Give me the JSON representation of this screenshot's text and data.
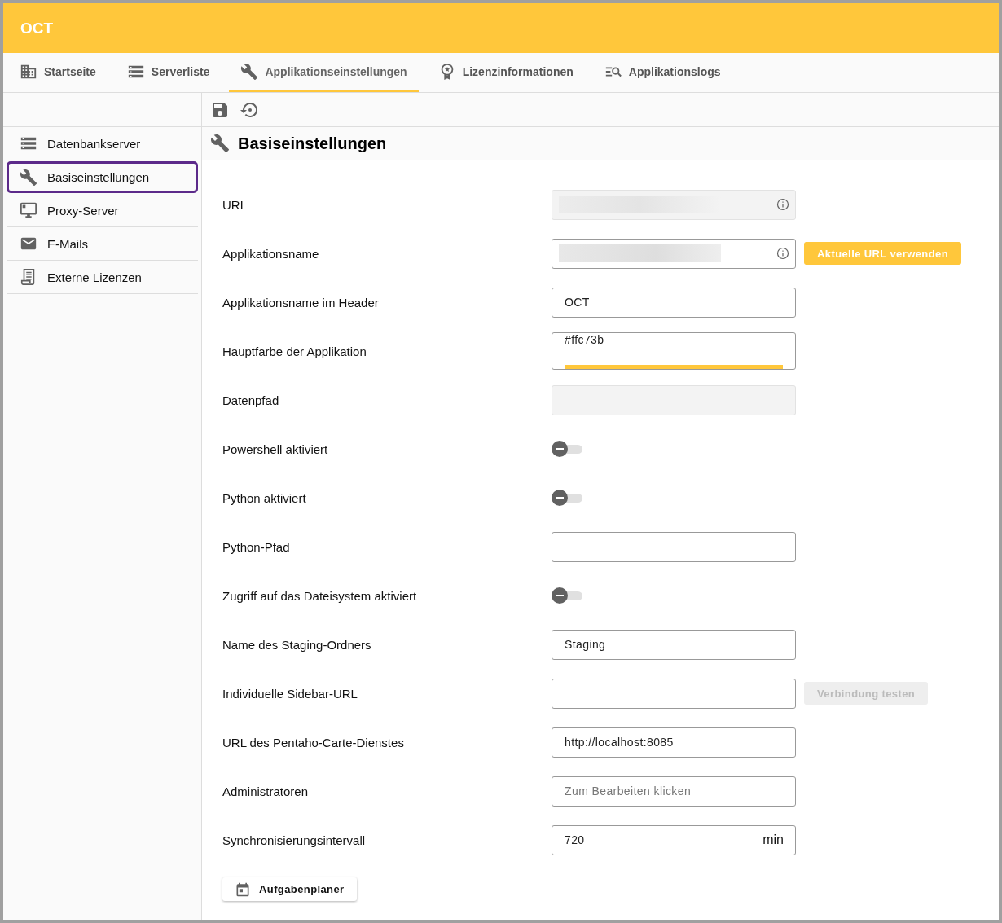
{
  "header": {
    "title": "OCT"
  },
  "tabs": [
    {
      "label": "Startseite",
      "selected": false
    },
    {
      "label": "Serverliste",
      "selected": false
    },
    {
      "label": "Applikationseinstellungen",
      "selected": true
    },
    {
      "label": "Lizenzinformationen",
      "selected": false
    },
    {
      "label": "Applikationslogs",
      "selected": false
    }
  ],
  "sidebar": {
    "items": [
      {
        "label": "Datenbankserver",
        "selected": false
      },
      {
        "label": "Basiseinstellungen",
        "selected": true
      },
      {
        "label": "Proxy-Server",
        "selected": false
      },
      {
        "label": "E-Mails",
        "selected": false
      },
      {
        "label": "Externe Lizenzen",
        "selected": false
      }
    ]
  },
  "section": {
    "title": "Basiseinstellungen"
  },
  "fields": [
    {
      "label": "URL",
      "kind": "redacted",
      "disabled": true,
      "info": true
    },
    {
      "label": "Applikationsname",
      "kind": "redacted",
      "disabled": false,
      "info": true,
      "button": {
        "label": "Aktuelle URL verwenden",
        "disabled": false
      }
    },
    {
      "label": "Applikationsname im Header",
      "kind": "text",
      "value": "OCT",
      "disabled": false
    },
    {
      "label": "Hauptfarbe der Applikation",
      "kind": "color",
      "value": "#ffc73b",
      "color": "#ffc73b",
      "disabled": false
    },
    {
      "label": "Datenpfad",
      "kind": "text",
      "disabled": true
    },
    {
      "label": "Powershell aktiviert",
      "kind": "toggle",
      "on": false
    },
    {
      "label": "Python aktiviert",
      "kind": "toggle",
      "on": false
    },
    {
      "label": "Python-Pfad",
      "kind": "text",
      "disabled": false
    },
    {
      "label": "Zugriff auf das Dateisystem aktiviert",
      "kind": "toggle",
      "on": false
    },
    {
      "label": "Name des Staging-Ordners",
      "kind": "text",
      "value": "Staging",
      "disabled": false
    },
    {
      "label": "Individuelle Sidebar-URL",
      "kind": "text",
      "disabled": false,
      "button": {
        "label": "Verbindung testen",
        "disabled": true
      }
    },
    {
      "label": "URL des Pentaho-Carte-Dienstes",
      "kind": "text",
      "value": "http://localhost:8085",
      "disabled": false
    },
    {
      "label": "Administratoren",
      "kind": "text",
      "placeholder": "Zum Bearbeiten klicken",
      "disabled": false
    },
    {
      "label": "Synchronisierungsintervall",
      "kind": "unit",
      "value": "720",
      "unit": "min",
      "disabled": false
    }
  ],
  "footer_button": {
    "label": "Aufgabenplaner"
  }
}
